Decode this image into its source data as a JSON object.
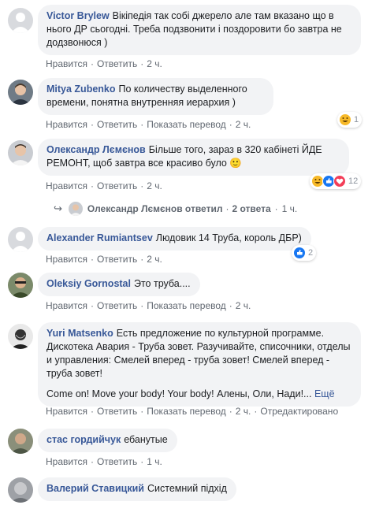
{
  "comments": [
    {
      "author": "Victor Brylew",
      "text": "Вікіпедія так собі джерело але там вказано що в нього ДР сьогодні. Треба подзвонити і поздоровити бо завтра не додзвонюся )",
      "like": "Нравится",
      "reply": "Ответить",
      "time": "2 ч."
    },
    {
      "author": "Mitya Zubenko",
      "text": "По количеству выделенного времени, понятна внутренняя иерархия )",
      "like": "Нравится",
      "reply": "Ответить",
      "translate": "Показать перевод",
      "time": "2 ч.",
      "reaction_count": "1"
    },
    {
      "author": "Олександр Лємєнов",
      "text": "Більше того, зараз в 320 кабінеті ЙДЕ РЕМОНТ, щоб завтра все красиво було",
      "emoji": "🙂",
      "like": "Нравится",
      "reply": "Ответить",
      "time": "2 ч.",
      "reaction_count": "12",
      "replies": {
        "arrow": "↪",
        "text": "Олександр Лємєнов ответил",
        "count": "2 ответа",
        "time": "1 ч."
      }
    },
    {
      "author": "Alexander Rumiantsev",
      "text": "Людовик 14 Труба, король ДБР)",
      "like": "Нравится",
      "reply": "Ответить",
      "time": "2 ч.",
      "reaction_count": "2"
    },
    {
      "author": "Oleksiy Gornostal",
      "text": "Это труба....",
      "like": "Нравится",
      "reply": "Ответить",
      "translate": "Показать перевод",
      "time": "2 ч."
    },
    {
      "author": "Yuri Matsenko",
      "text": "Есть предложение по культурной программе. Дискотека Авария - Труба зовет. Разучивайте, списочники, отделы и управления: Смелей вперед - труба зовет! Смелей вперед - труба зовет!",
      "text2": "Come on! Move your body! Your body! Алены, Оли, Нади!...",
      "more": "Ещё",
      "like": "Нравится",
      "reply": "Ответить",
      "translate": "Показать перевод",
      "time": "2 ч.",
      "edited": "Отредактировано"
    },
    {
      "author": "стас гордийчук",
      "text": "ебанутые",
      "like": "Нравится",
      "reply": "Ответить",
      "time": "1 ч."
    },
    {
      "author": "Валерий Ставицкий",
      "text": "Системний підхід"
    }
  ],
  "separator": "·",
  "colors": {
    "author": "#385898",
    "bubble": "#f2f3f5",
    "meta": "#606770",
    "like_blue": "#1877f2",
    "haha_yellow": "#f7b928",
    "love_red": "#f33e58"
  },
  "icons": {
    "haha": "haha-reaction-icon",
    "like": "like-reaction-icon",
    "love": "love-reaction-icon",
    "reply_arrow": "reply-arrow-icon"
  }
}
